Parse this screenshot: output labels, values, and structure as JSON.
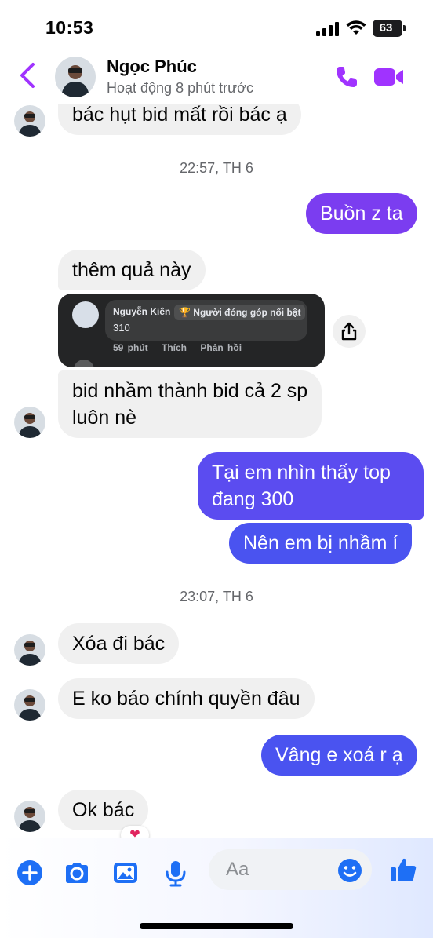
{
  "status_bar": {
    "time": "10:53",
    "battery": "63"
  },
  "header": {
    "contact_name": "Ngọc Phúc",
    "activity": "Hoạt động 8 phút trước"
  },
  "icons": {
    "back": "chevron-left-icon",
    "call": "phone-icon",
    "video": "video-camera-icon",
    "share": "share-icon",
    "add": "plus-icon",
    "camera": "camera-icon",
    "gallery": "image-icon",
    "mic": "microphone-icon",
    "emoji": "smile-icon",
    "like": "thumbs-up-icon"
  },
  "colors": {
    "accent": "#a033ff",
    "outgoing_start": "#7b3df0",
    "outgoing_end": "#4a53f0",
    "incoming": "#f0f0f0"
  },
  "messages": {
    "m1": "bác hụt bid mất rồi bác ạ",
    "ts1": "22:57, TH 6",
    "m2": "Buồn z ta",
    "m3": "thêm quả này",
    "m4_line1": "bid nhầm thành bid cả 2 sp",
    "m4_line2": "luôn nè",
    "m5_line1": "Tại em nhìn thấy top",
    "m5_line2": "đang 300",
    "m6": "Nên em bị nhầm í",
    "ts2": "23:07, TH 6",
    "m7": "Xóa đi bác",
    "m8": "E ko báo chính quyền đâu",
    "m9": "Vâng e xoá r ạ",
    "m10": "Ok bác",
    "m10_reaction": "❤"
  },
  "shared_card": {
    "author": "Nguyễn Kiên",
    "badge": "🏆 Người đóng góp nổi bật",
    "comment": "310",
    "time": "59 phút",
    "like": "Thích",
    "reply": "Phản hồi"
  },
  "composer": {
    "placeholder": "Aa"
  }
}
